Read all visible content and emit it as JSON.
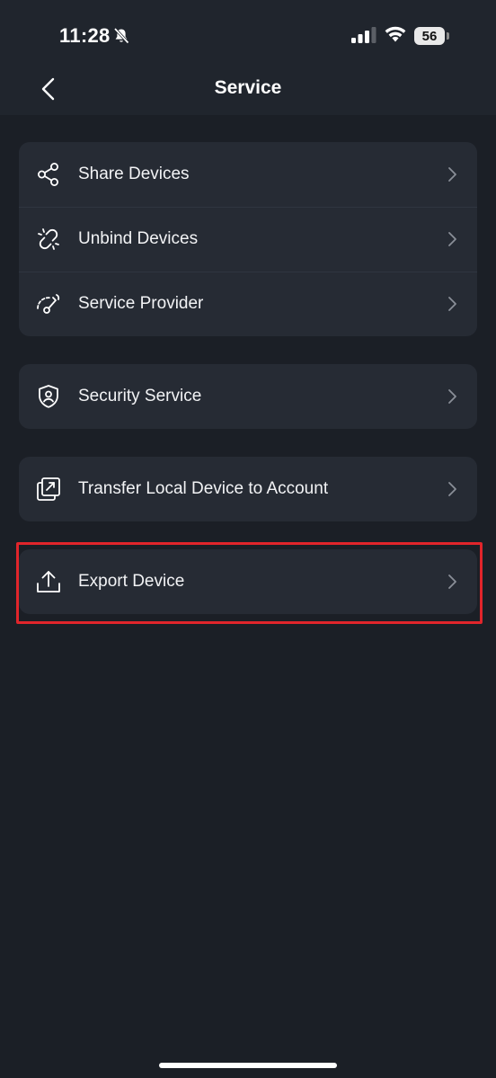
{
  "status_bar": {
    "time": "11:28",
    "battery": "56"
  },
  "header": {
    "title": "Service"
  },
  "groups": [
    {
      "items": [
        {
          "icon": "share-icon",
          "label": "Share Devices"
        },
        {
          "icon": "unbind-link-icon",
          "label": "Unbind Devices"
        },
        {
          "icon": "service-provider-icon",
          "label": "Service Provider"
        }
      ]
    },
    {
      "items": [
        {
          "icon": "shield-user-icon",
          "label": "Security Service"
        }
      ]
    },
    {
      "items": [
        {
          "icon": "transfer-icon",
          "label": "Transfer Local Device to Account"
        }
      ]
    },
    {
      "items": [
        {
          "icon": "upload-icon",
          "label": "Export Device"
        }
      ]
    }
  ],
  "colors": {
    "background": "#1b1f26",
    "header": "#20252d",
    "card": "#262b34",
    "highlight": "#e1252b"
  }
}
